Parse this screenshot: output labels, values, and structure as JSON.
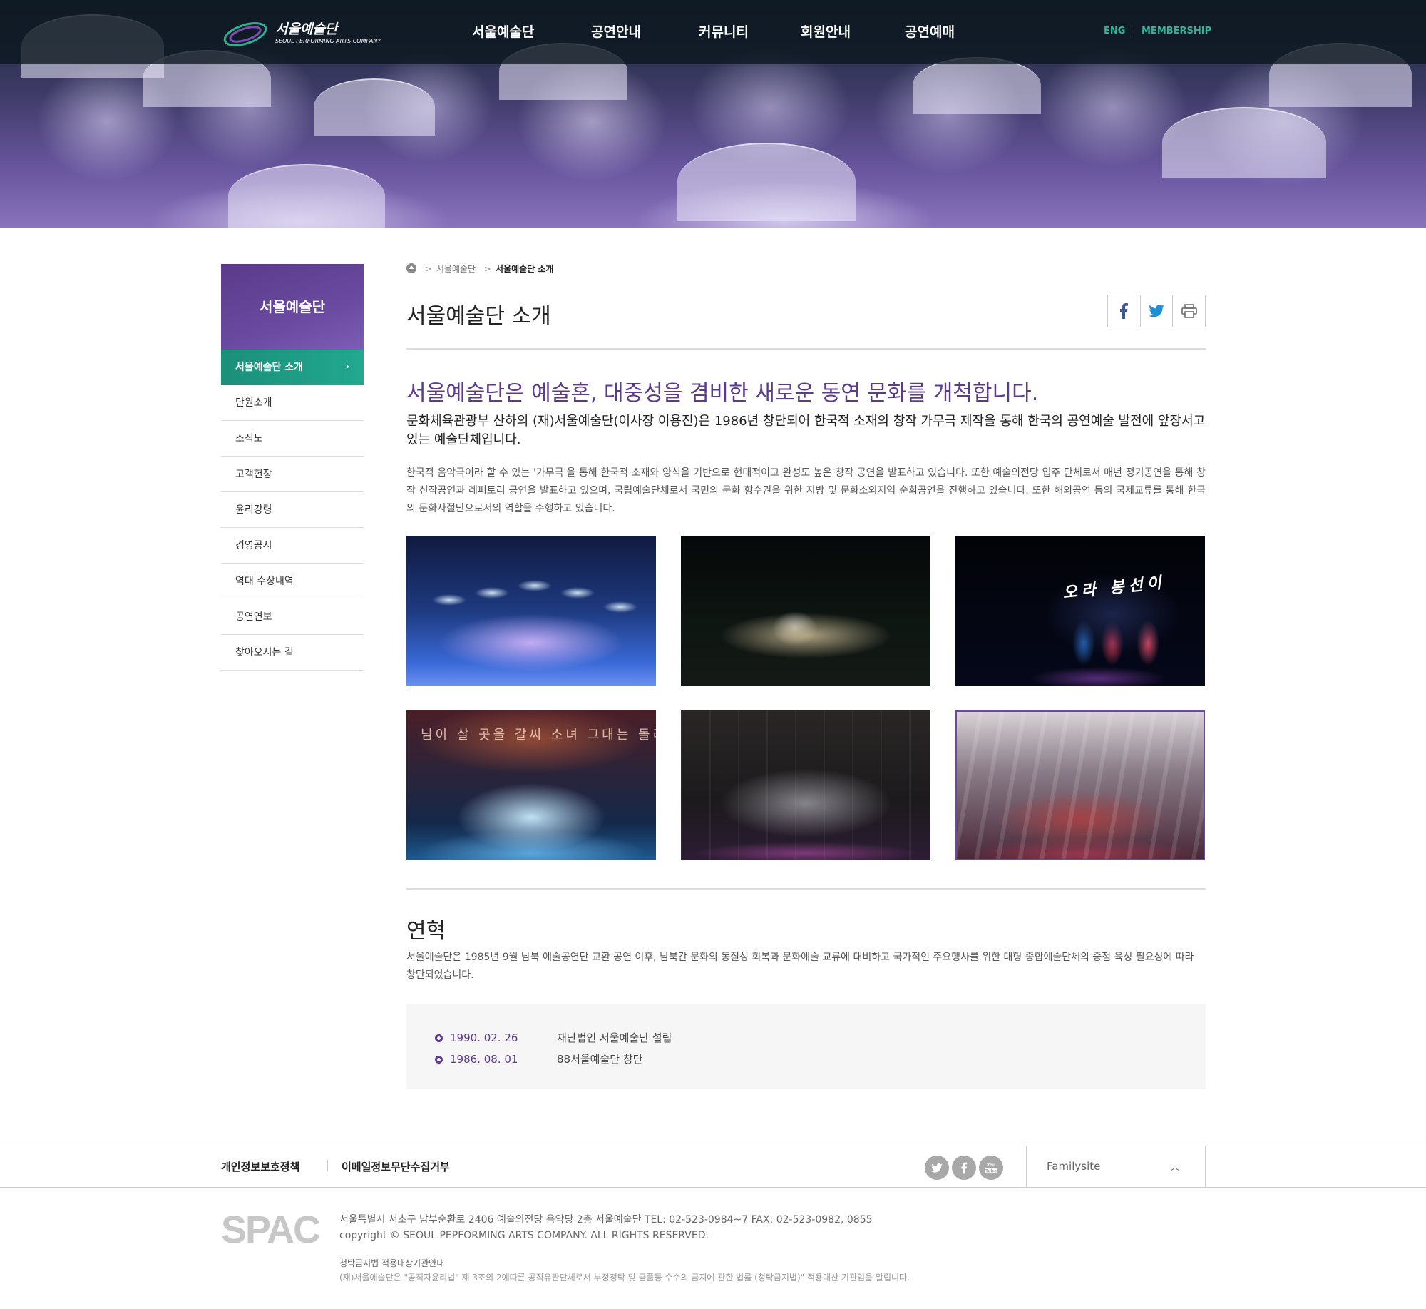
{
  "header": {
    "logo_ko": "서울예술단",
    "logo_en": "SEOUL PERFORMING ARTS COMPANY",
    "menu": [
      "서울예술단",
      "공연안내",
      "커뮤니티",
      "회원안내",
      "공연예매"
    ],
    "util": [
      "ENG",
      "MEMBERSHIP"
    ]
  },
  "lnb": {
    "title": "서울예술단",
    "active": "서울예술단 소개",
    "items": [
      "단원소개",
      "조직도",
      "고객헌장",
      "윤리강령",
      "경영공시",
      "역대 수상내역",
      "공연연보",
      "찾아오시는 길"
    ]
  },
  "breadcrumb": [
    "서울예술단",
    "서울예술단 소개"
  ],
  "page": {
    "title": "서울예술단 소개",
    "lead": "서울예술단은 예술혼, 대중성을 겸비한 새로운 동연 문화를 개척합니다.",
    "sub": "문화체육관광부 산하의 (재)서울예술단(이사장 이용진)은 1986년 창단되어 한국적 소재의 창작 가무극 제작을 통해 한국의 공연예술 발전에 앞장서고 있는 예술단체입니다.",
    "desc": "한국적 음악극이라 할 수 있는 '가무극'을 통해 한국적 소재와 양식을 기반으로 현대적이고 완성도 높은 창작 공연을 발표하고 있습니다. 또한 예술의전당 입주 단체로서 매년 정기공연을 통해 창작 신작공연과 레퍼토리 공연을 발표하고 있으며, 국립예술단체로서 국민의 문화 향수권을 위한 지방 및 문화소외지역 순회공연을 진행하고 있습니다. 또한 해외공연 등의 국제교류를 통해 한국의 문화사절단으로서의 역할을 수행하고 있습니다.",
    "photo_texts": [
      "오라 봉선이",
      "님이 살 곳을 갈씨 소녀 그대는 돌리는가"
    ],
    "history_title": "연혁",
    "history_desc": "서울예술단은 1985년 9월 남북 예술공연단 교환 공연 이후, 남북간 문화의 동질성 회복과 문화예술 교류에 대비하고 국가적인 주요행사를 위한 대형 종합예술단체의 중점 육성 필요성에 따라 창단되었습니다.",
    "history": [
      {
        "date": "1990. 02. 26",
        "event": "재단법인 서울예술단 설립"
      },
      {
        "date": "1986. 08. 01",
        "event": "88서울예술단 창단"
      }
    ]
  },
  "footer": {
    "links": [
      "개인정보보호정책",
      "이메일정보무단수집거부"
    ],
    "familysite": "Familysite",
    "logo": "SPAC",
    "address": "서울특별시 서초구 남부순환로 2406 예술의전당 음악당 2층 서울예술단    TEL: 02-523-0984~7    FAX: 02-523-0982, 0855",
    "copyright": "copyright © SEOUL PEPFORMING ARTS COMPANY. ALL RIGHTS RESERVED.",
    "notice_title": "청탁금지법 적용대상기관안내",
    "notice": "(재)서울예술단은 \"공직자윤리법\" 제 3조의 2에따른 공직유관단체로서  부정청탁 및 금품등 수수의 금지에 관한 법률 (청탁금지법)\" 적용대산 기관임을 알립니다."
  },
  "colors": {
    "brand_purple": "#5c3a8e",
    "accent_green": "#21a98f",
    "util_green": "#2fb59b"
  },
  "icons": [
    "home-icon",
    "facebook-icon",
    "twitter-icon",
    "print-icon",
    "youtube-icon",
    "chevron-up-icon",
    "chevron-right-icon"
  ]
}
